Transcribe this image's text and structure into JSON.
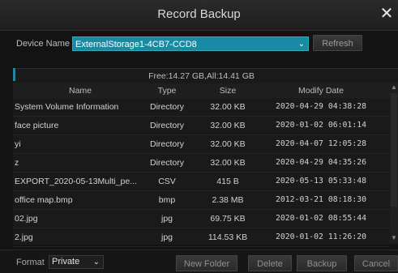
{
  "window": {
    "title": "Record Backup",
    "close_icon": "close-icon"
  },
  "device": {
    "label": "Device Name",
    "selected": "ExternalStorage1-4CB7-CCD8",
    "refresh_label": "Refresh"
  },
  "storage": {
    "free_text": "Free:14.27 GB,All:14.41 GB"
  },
  "table": {
    "columns": [
      "Name",
      "Type",
      "Size",
      "Modify Date"
    ],
    "rows": [
      {
        "name": "System Volume Information",
        "type": "Directory",
        "size": "32.00 KB",
        "date": "2020-04-29 04:38:28"
      },
      {
        "name": "face picture",
        "type": "Directory",
        "size": "32.00 KB",
        "date": "2020-01-02 06:01:14"
      },
      {
        "name": "yi",
        "type": "Directory",
        "size": "32.00 KB",
        "date": "2020-04-07 12:05:28"
      },
      {
        "name": "z",
        "type": "Directory",
        "size": "32.00 KB",
        "date": "2020-04-29 04:35:26"
      },
      {
        "name": "EXPORT_2020-05-13Multi_pe...",
        "type": "CSV",
        "size": "415 B",
        "date": "2020-05-13 05:33:48"
      },
      {
        "name": "office map.bmp",
        "type": "bmp",
        "size": "2.38 MB",
        "date": "2012-03-21 08:18:30"
      },
      {
        "name": "02.jpg",
        "type": "jpg",
        "size": "69.75 KB",
        "date": "2020-01-02 08:55:44"
      },
      {
        "name": "2.jpg",
        "type": "jpg",
        "size": "114.53 KB",
        "date": "2020-01-02 11:26:20"
      }
    ]
  },
  "footer": {
    "format_label": "Format",
    "format_selected": "Private",
    "new_folder_label": "New Folder",
    "delete_label": "Delete",
    "backup_label": "Backup",
    "cancel_label": "Cancel"
  },
  "colors": {
    "accent": "#1a8aa3",
    "background": "#131313"
  }
}
